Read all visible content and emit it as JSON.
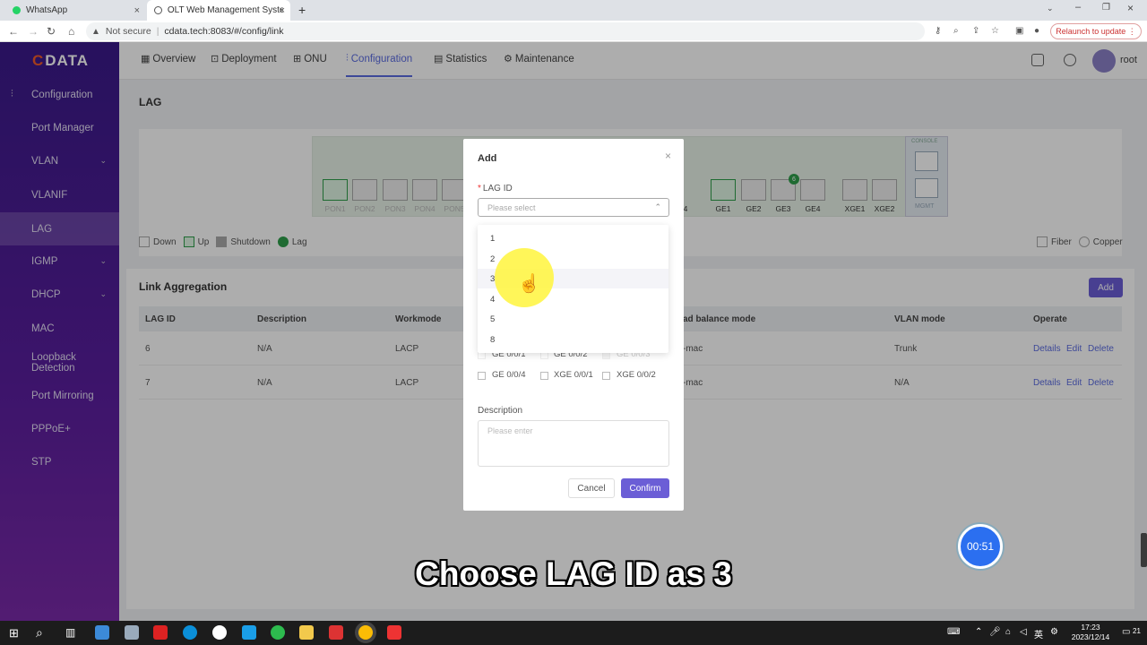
{
  "browser": {
    "tabs": [
      {
        "title": "WhatsApp",
        "active": false
      },
      {
        "title": "OLT Web Management Syster",
        "active": true
      }
    ],
    "new_tab": "+",
    "security": "Not secure",
    "url": "cdata.tech:8083/#/config/link",
    "relaunch": "Relaunch to update"
  },
  "app": {
    "logo": "DATA",
    "logo_mark": "C",
    "topnav": [
      "Overview",
      "Deployment",
      "ONU",
      "Configuration",
      "Statistics",
      "Maintenance"
    ],
    "active_topnav": "Configuration",
    "user": "root",
    "sidebar": {
      "header": "Configuration",
      "items": [
        {
          "label": "Port Manager",
          "expand": false
        },
        {
          "label": "VLAN",
          "expand": true
        },
        {
          "label": "VLANIF",
          "expand": false
        },
        {
          "label": "LAG",
          "expand": false
        },
        {
          "label": "IGMP",
          "expand": true
        },
        {
          "label": "DHCP",
          "expand": true
        },
        {
          "label": "MAC",
          "expand": false
        },
        {
          "label": "Loopback Detection",
          "expand": false
        },
        {
          "label": "Port Mirroring",
          "expand": false
        },
        {
          "label": "PPPoE+",
          "expand": false
        },
        {
          "label": "STP",
          "expand": false
        }
      ],
      "selected": "LAG"
    },
    "page_title": "LAG",
    "ports": {
      "pon": [
        "PON1",
        "PON2",
        "PON3",
        "PON4",
        "PON5"
      ],
      "ge_partial": "4",
      "ge": [
        "GE1",
        "GE2",
        "GE3",
        "GE4"
      ],
      "xge": [
        "XGE1",
        "XGE2"
      ],
      "console_label": "CONSOLE",
      "mgmt_label": "MGMT",
      "lag_badge": "6"
    },
    "legend": {
      "down": "Down",
      "up": "Up",
      "shutdown": "Shutdown",
      "lag": "Lag",
      "fiber": "Fiber",
      "copper": "Copper"
    },
    "link_aggregation": {
      "title": "Link Aggregation",
      "add_label": "Add",
      "columns": [
        "LAG ID",
        "Description",
        "Workmode",
        "Load balance mode",
        "VLAN mode",
        "Operate"
      ],
      "rows": [
        {
          "lag_id": "6",
          "description": "N/A",
          "workmode": "LACP",
          "balance": "-mac",
          "vlan_mode": "Trunk"
        },
        {
          "lag_id": "7",
          "description": "N/A",
          "workmode": "LACP",
          "balance": "-mac",
          "vlan_mode": "N/A"
        }
      ],
      "actions": [
        "Details",
        "Edit",
        "Delete"
      ],
      "balance_header_partial": "ad balance mode"
    }
  },
  "modal": {
    "title": "Add",
    "close": "×",
    "lag_id_label": "LAG ID",
    "lag_id_placeholder": "Please select",
    "options": [
      "1",
      "2",
      "3",
      "4",
      "5",
      "8"
    ],
    "hovered_option": "3",
    "port_checkboxes": [
      "GE 0/0/1",
      "GE 0/0/2",
      "GE 0/0/3",
      "GE 0/0/4",
      "XGE 0/0/1",
      "XGE 0/0/2"
    ],
    "description_label": "Description",
    "description_placeholder": "Please enter",
    "cancel": "Cancel",
    "confirm": "Confirm"
  },
  "overlay_video": {
    "timer": "00:51",
    "caption": "Choose LAG ID as 3"
  },
  "taskbar": {
    "time": "17:23",
    "date": "2023/12/14",
    "ime": "英",
    "notif": "21"
  }
}
